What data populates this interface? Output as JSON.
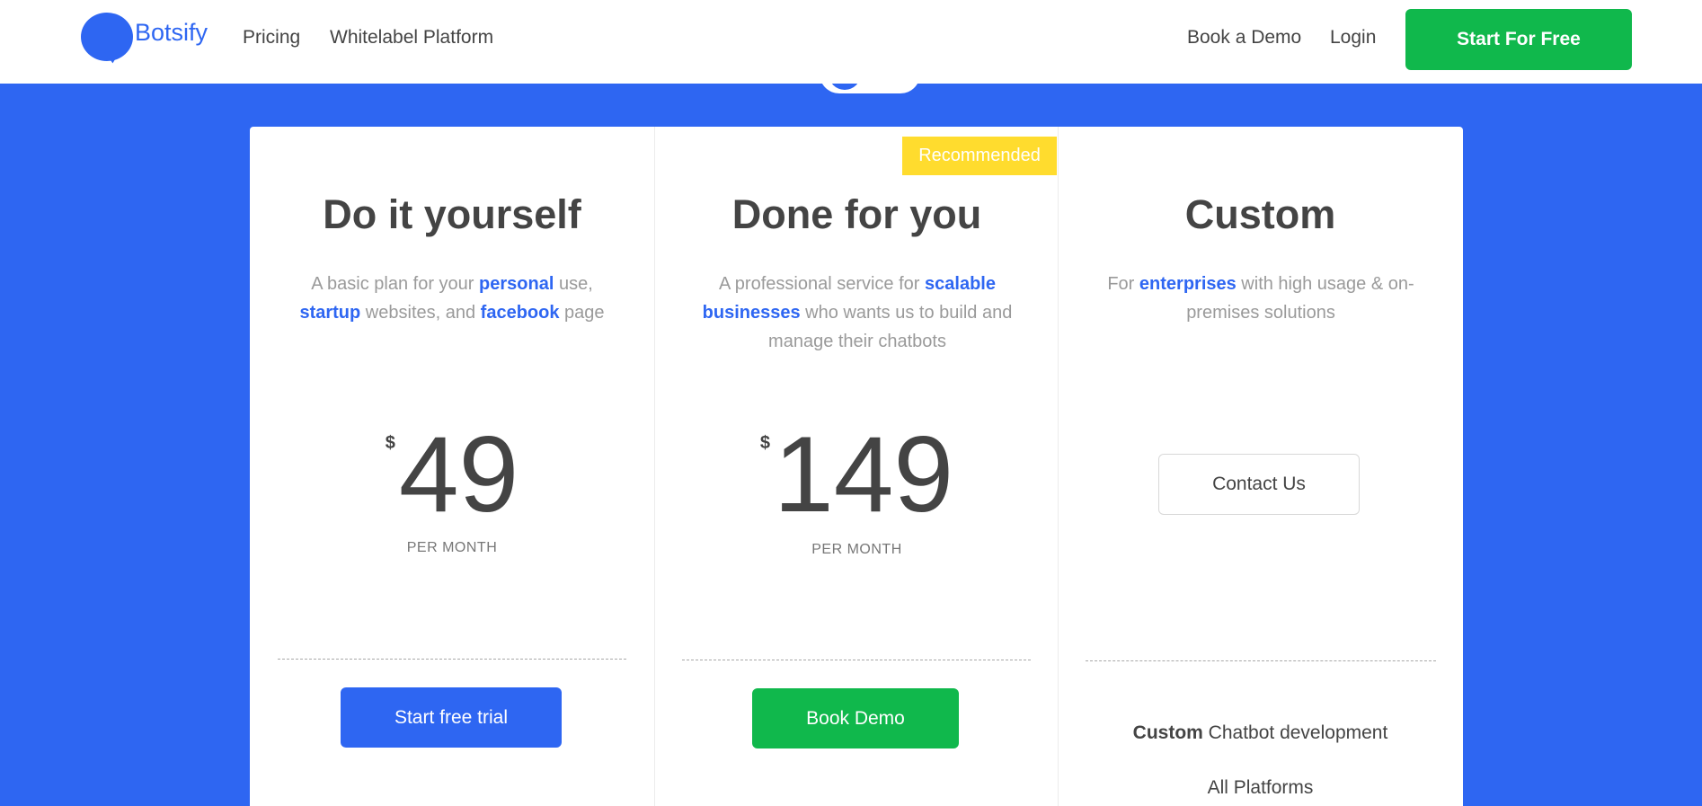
{
  "nav": {
    "brand": "Botsify",
    "links": [
      "Pricing",
      "Whitelabel Platform",
      "Book a Demo",
      "Login"
    ],
    "cta": "Start For Free"
  },
  "plans": [
    {
      "title": "Do it yourself",
      "desc": [
        "A basic plan for your ",
        "personal",
        " use, ",
        "startup",
        " websites, and ",
        "facebook",
        " page"
      ],
      "currency": "$",
      "price": "49",
      "period": "PER MONTH",
      "button": "Start free trial"
    },
    {
      "badge": "Recommended",
      "title": "Done for you",
      "desc": [
        "A professional service for ",
        "scalable businesses",
        " who wants us to build and manage their chatbots"
      ],
      "currency": "$",
      "price": "149",
      "period": "PER MONTH",
      "button": "Book Demo"
    },
    {
      "title": "Custom",
      "desc": [
        "For ",
        "enterprises",
        " with high usage & on-premises solutions"
      ],
      "button": "Contact Us",
      "features": [
        {
          "bold": "Custom",
          "text": " Chatbot development"
        },
        {
          "text": "All Platforms"
        }
      ]
    }
  ],
  "colors": {
    "primary": "#2e66f2",
    "accent": "#10b84c",
    "badge": "#ffdc2e"
  }
}
